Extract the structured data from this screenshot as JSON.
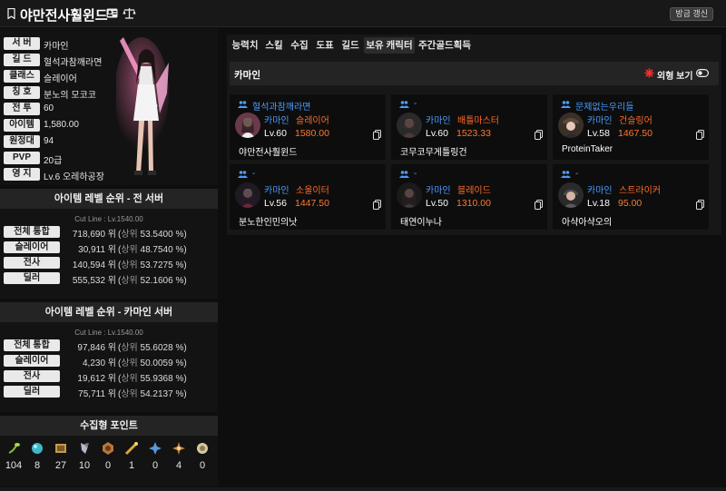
{
  "header": {
    "title": "야만전사훨윈드",
    "refresh_label": "방금 갱신",
    "icons": [
      "bookmark-icon",
      "id-card-icon",
      "scale-icon"
    ]
  },
  "profile": {
    "server": {
      "label": "서 버",
      "value": "카마인"
    },
    "guild": {
      "label": "길 드",
      "value": "혈석과참깨라면"
    },
    "class": {
      "label": "클래스",
      "value": "슬레이어"
    },
    "title": {
      "label": "칭 호",
      "value": "분노의 모코코"
    },
    "combat": {
      "label": "전 투",
      "value": "60"
    },
    "item": {
      "label": "아이템",
      "value": "1,580.00"
    },
    "expedition": {
      "label": "원정대",
      "value": "94"
    },
    "pvp": {
      "label": "PVP",
      "value": "20급"
    },
    "estate": {
      "label": "영 지",
      "value": "Lv.6 오레하공장"
    }
  },
  "rank_all": {
    "header": "아이템 레벨 순위 - 전 서버",
    "cutline": "Cut Line : Lv.1540.00",
    "rows": [
      {
        "label": "전체 통합",
        "rank": "718,690 위",
        "paren": "(",
        "upper": "상위",
        "pct": "53.5400 %)"
      },
      {
        "label": "슬레이어",
        "rank": "30,911 위",
        "paren": "(",
        "upper": "상위",
        "pct": "48.7540 %)"
      },
      {
        "label": "전사",
        "rank": "140,594 위",
        "paren": "(",
        "upper": "상위",
        "pct": "53.7275 %)"
      },
      {
        "label": "딜러",
        "rank": "555,532 위",
        "paren": "(",
        "upper": "상위",
        "pct": "52.1606 %)"
      }
    ]
  },
  "rank_server": {
    "header": "아이템 레벨 순위 - 카마인 서버",
    "cutline": "Cut Line : Lv.1540.00",
    "rows": [
      {
        "label": "전체 통합",
        "rank": "97,846 위",
        "paren": "(",
        "upper": "상위",
        "pct": "55.6028 %)"
      },
      {
        "label": "슬레이어",
        "rank": "4,230 위",
        "paren": "(",
        "upper": "상위",
        "pct": "50.0059 %)"
      },
      {
        "label": "전사",
        "rank": "19,612 위",
        "paren": "(",
        "upper": "상위",
        "pct": "55.9368 %)"
      },
      {
        "label": "딜러",
        "rank": "75,711 위",
        "paren": "(",
        "upper": "상위",
        "pct": "54.2137 %)"
      }
    ]
  },
  "collection": {
    "header": "수집형 포인트",
    "items": [
      {
        "icon": "mokoko-seed-icon",
        "value": "104",
        "color": "#8ab83a"
      },
      {
        "icon": "island-heart-icon",
        "value": "8",
        "color": "#3fb8c8"
      },
      {
        "icon": "great-art-icon",
        "value": "27",
        "color": "#c89a4a"
      },
      {
        "icon": "giant-heart-icon",
        "value": "10",
        "color": "#b8b8c8"
      },
      {
        "icon": "ignea-token-icon",
        "value": "0",
        "color": "#b87838"
      },
      {
        "icon": "world-tree-leaf-icon",
        "value": "1",
        "color": "#d8a838"
      },
      {
        "icon": "orpheus-star-icon",
        "value": "0",
        "color": "#5a9ad8"
      },
      {
        "icon": "orgel-icon",
        "value": "4",
        "color": "#c88a3a"
      },
      {
        "icon": "sea-bounty-icon",
        "value": "0",
        "color": "#d8c8a0"
      }
    ]
  },
  "tabs": [
    {
      "label": "능력치",
      "active": false
    },
    {
      "label": "스킬",
      "active": false
    },
    {
      "label": "수집",
      "active": false
    },
    {
      "label": "도표",
      "active": false
    },
    {
      "label": "길드",
      "active": false
    },
    {
      "label": "보유 캐릭터",
      "active": true
    },
    {
      "label": "주간골드획득",
      "active": false
    }
  ],
  "characters_section": {
    "server": "카마인",
    "view_label": "외형 보기",
    "accent": "#ff2b2b"
  },
  "characters": [
    {
      "guild": "혈석과참깨라면",
      "server": "카마인",
      "cls": "슬레이어",
      "level": "Lv.60",
      "ilvl": "1580.00",
      "name": "야만전사훨윈드"
    },
    {
      "guild": "-",
      "server": "카마인",
      "cls": "배틀마스터",
      "level": "Lv.60",
      "ilvl": "1523.33",
      "name": "코무코무게틀링건"
    },
    {
      "guild": "문제없는우리들",
      "server": "카마인",
      "cls": "건슬링어",
      "level": "Lv.58",
      "ilvl": "1467.50",
      "name": "ProteinTaker"
    },
    {
      "guild": "-",
      "server": "카마인",
      "cls": "소울이터",
      "level": "Lv.56",
      "ilvl": "1447.50",
      "name": "분노한인민의낫"
    },
    {
      "guild": "-",
      "server": "카마인",
      "cls": "블레이드",
      "level": "Lv.50",
      "ilvl": "1310.00",
      "name": "태연이누나"
    },
    {
      "guild": "-",
      "server": "카마인",
      "cls": "스트라이커",
      "level": "Lv.18",
      "ilvl": "95.00",
      "name": "아샥아샥오의"
    }
  ]
}
